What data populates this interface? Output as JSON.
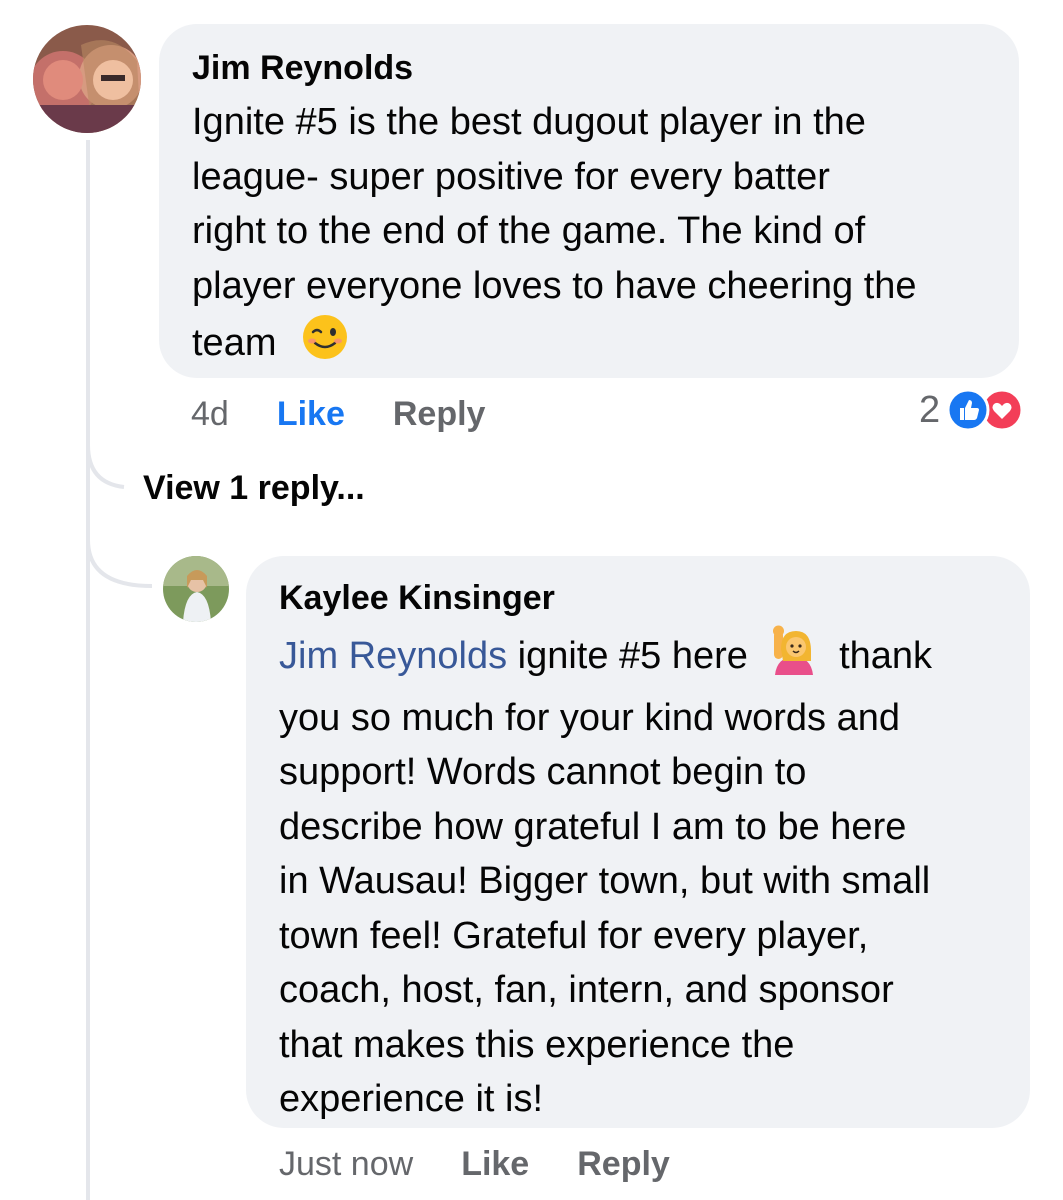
{
  "comment": {
    "author": "Jim Reynolds",
    "text_lines": [
      "Ignite #5 is the best dugout player in the",
      "league- super positive for every batter",
      "right to the end of the game. The kind of",
      "player everyone loves to have cheering the",
      "team"
    ],
    "emoji": "winking-face",
    "timestamp": "4d",
    "like_label": "Like",
    "reply_label": "Reply",
    "reaction_count": "2",
    "reactions": [
      "like",
      "love"
    ],
    "colors": {
      "like_blue": "#1877f2",
      "love_red": "#f33e58"
    }
  },
  "view_replies_label": "View 1 reply...",
  "reply": {
    "author": "Kaylee Kinsinger",
    "mention": "Jim Reynolds",
    "first_line_rest_a": "ignite #5 here",
    "emoji": "person-raising-hand",
    "first_line_rest_b": "thank",
    "text_lines": [
      "you so much for your kind words and",
      "support! Words cannot begin to",
      "describe how grateful I am to be here",
      "in Wausau! Bigger town, but with small",
      "town feel! Grateful for every player,",
      "coach, host, fan, intern, and sponsor",
      "that makes this experience the",
      "experience it is!"
    ],
    "timestamp": "Just now",
    "like_label": "Like",
    "reply_label": "Reply"
  }
}
